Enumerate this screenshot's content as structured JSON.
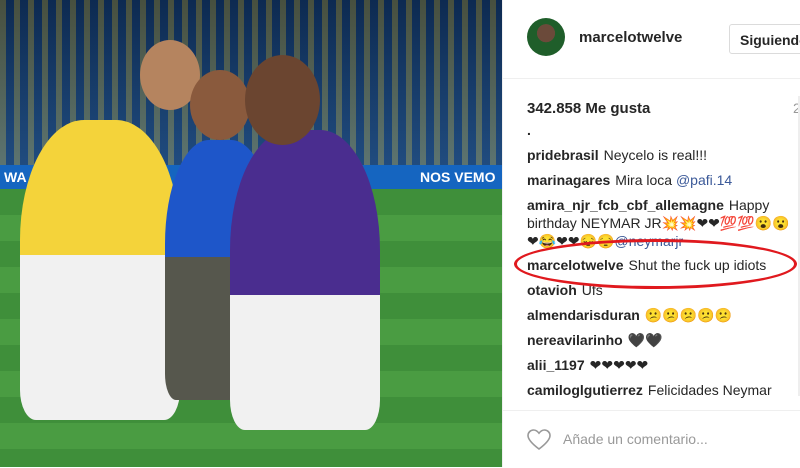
{
  "photo": {
    "banner_left": "WA CUP",
    "banner_right": "NOS VEMO"
  },
  "header": {
    "username": "marcelotwelve",
    "follow_label": "Siguiendo",
    "avatar": "profile-avatar"
  },
  "post": {
    "likes": "342.858 Me gusta",
    "date": "2",
    "dot": "."
  },
  "comments": [
    {
      "user": "pridebrasil",
      "text": "Neycelo is real!!!"
    },
    {
      "user": "marinagares",
      "text": "Mira loca ",
      "mention": "@pafi.14"
    },
    {
      "user": "amira_njr_fcb_cbf_allemagne",
      "text": "Happy birthday NEYMAR JR💥💥❤❤💯💯😮😮❤😂❤❤😔😔",
      "mention": "@neymarjr"
    },
    {
      "user": "marcelotwelve",
      "text": "Shut the fuck up idiots"
    },
    {
      "user": "otavioh",
      "text": "Ufs"
    },
    {
      "user": "almendarisduran",
      "text": "😕😕😕😕😕"
    },
    {
      "user": "nereavilarinho",
      "text": "🖤🖤"
    },
    {
      "user": "alii_1197",
      "text": "❤❤❤❤❤"
    },
    {
      "user": "camiloglgutierrez",
      "text": "Felicidades Neymar"
    }
  ],
  "footer": {
    "add_comment_placeholder": "Añade un comentario...",
    "heart_icon": "heart-icon"
  },
  "colors": {
    "highlight_ring": "#e0191e",
    "mention": "#3b5998"
  }
}
